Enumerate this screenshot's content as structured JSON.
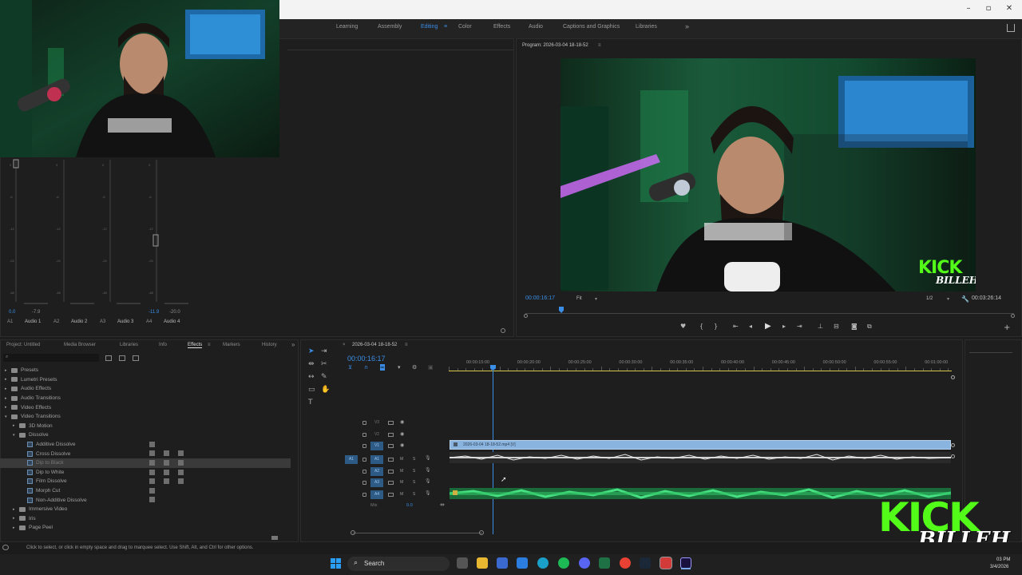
{
  "workspaces": {
    "tabs": [
      "Learning",
      "Assembly",
      "Editing",
      "Color",
      "Effects",
      "Audio",
      "Captions and Graphics",
      "Libraries"
    ],
    "active": "Editing",
    "more": "»"
  },
  "window_controls": {
    "minimize": "–",
    "restore": "▫",
    "close": "✕"
  },
  "program_monitor": {
    "title": "Program: 2026-03-04 18-18-52",
    "menu": "≡",
    "current_time": "00:00:16:17",
    "fit": "Fit",
    "resolution": "1/2",
    "duration": "00:03:26:14"
  },
  "overlay": {
    "kick": "KICK",
    "billeh": "BILLEH"
  },
  "mixer": {
    "channels": [
      {
        "ch": "A1",
        "name": "Audio 1",
        "value": "-7.9"
      },
      {
        "ch": "A2",
        "name": "Audio 2",
        "value": ""
      },
      {
        "ch": "A3",
        "name": "Audio 3",
        "value": ""
      },
      {
        "ch": "A4",
        "name": "Audio 4",
        "value": "-20.0"
      }
    ],
    "left_value": "0.0",
    "a4_left": "-11.9"
  },
  "project_panel": {
    "tabs": [
      "Project: Untitled",
      "Media Browser",
      "Libraries",
      "Info",
      "Effects",
      "Markers",
      "History"
    ],
    "active": "Effects",
    "tree": [
      {
        "label": "Presets",
        "level": 0,
        "type": "folder"
      },
      {
        "label": "Lumetri Presets",
        "level": 0,
        "type": "folder"
      },
      {
        "label": "Audio Effects",
        "level": 0,
        "type": "folder"
      },
      {
        "label": "Audio Transitions",
        "level": 0,
        "type": "folder"
      },
      {
        "label": "Video Effects",
        "level": 0,
        "type": "folder"
      },
      {
        "label": "Video Transitions",
        "level": 0,
        "type": "folder"
      },
      {
        "label": "3D Motion",
        "level": 1,
        "type": "folder"
      },
      {
        "label": "Dissolve",
        "level": 1,
        "type": "folder"
      },
      {
        "label": "Additive Dissolve",
        "level": 2,
        "type": "fx",
        "badges": 1
      },
      {
        "label": "Cross Dissolve",
        "level": 2,
        "type": "fx",
        "badges": 3
      },
      {
        "label": "Dip to Black",
        "level": 2,
        "type": "fx",
        "badges": 3,
        "selected": true
      },
      {
        "label": "Dip to White",
        "level": 2,
        "type": "fx",
        "badges": 3
      },
      {
        "label": "Film Dissolve",
        "level": 2,
        "type": "fx",
        "badges": 3
      },
      {
        "label": "Morph Cut",
        "level": 2,
        "type": "fx",
        "badges": 1
      },
      {
        "label": "Non-Additive Dissolve",
        "level": 2,
        "type": "fx",
        "badges": 1
      },
      {
        "label": "Immersive Video",
        "level": 1,
        "type": "folder"
      },
      {
        "label": "Iris",
        "level": 1,
        "type": "folder"
      },
      {
        "label": "Page Peel",
        "level": 1,
        "type": "folder"
      }
    ]
  },
  "timeline": {
    "title": "2026-03-04 18-18-52",
    "timecode": "00:00:16:17",
    "ruler": [
      "00:00:15:00",
      "00:00:20:00",
      "00:00:25:00",
      "00:00:30:00",
      "00:00:35:00",
      "00:00:40:00",
      "00:00:45:00",
      "00:00:50:00",
      "00:00:55:00",
      "00:01:00:00"
    ],
    "tracks": [
      {
        "id": "V3"
      },
      {
        "id": "V2"
      },
      {
        "id": "V1"
      },
      {
        "id": "A1",
        "src": "A1"
      },
      {
        "id": "A2"
      },
      {
        "id": "A3"
      },
      {
        "id": "A4"
      }
    ],
    "mix_label": "Mix",
    "mix_value": "0.0",
    "clip_label": "2026-03-04 18-18-52.mp4 [V]"
  },
  "status_bar": {
    "hint": "Click to select, or click in empty space and drag to marquee select. Use Shift, Alt, and Ctrl for other options."
  },
  "taskbar": {
    "search": "Search",
    "time": "03 PM",
    "date": "3/4/2026"
  },
  "colors": {
    "accent": "#3a8ee6",
    "video_clip": "#8ab4e0",
    "audio_clip": "#2fbf63",
    "kick_green": "#53fc18"
  }
}
